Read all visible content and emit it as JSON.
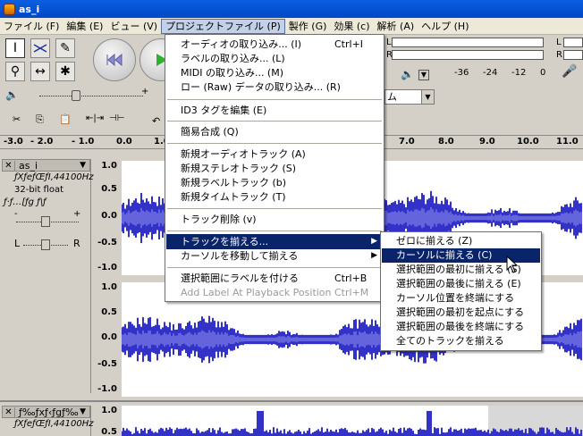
{
  "window": {
    "title": "as_i"
  },
  "menubar": [
    {
      "label": "ファイル (F)"
    },
    {
      "label": "編集 (E)"
    },
    {
      "label": "ビュー (V)"
    },
    {
      "label": "プロジェクトファイル (P)"
    },
    {
      "label": "製作 (G)"
    },
    {
      "label": "効果 (c)"
    },
    {
      "label": "解析 (A)"
    },
    {
      "label": "ヘルプ (H)"
    }
  ],
  "project_menu": {
    "items": [
      {
        "label": "オーディオの取り込み... (I)",
        "shortcut": "Ctrl+I"
      },
      {
        "label": "ラベルの取り込み... (L)",
        "shortcut": ""
      },
      {
        "label": "MIDI の取り込み... (M)",
        "shortcut": ""
      },
      {
        "label": "ロー (Raw) データの取り込み... (R)",
        "shortcut": ""
      },
      {
        "label": "ID3 タグを編集 (E)",
        "shortcut": ""
      },
      {
        "label": "簡易合成 (Q)",
        "shortcut": ""
      },
      {
        "label": "新規オーディオトラック (A)",
        "shortcut": ""
      },
      {
        "label": "新規ステレオトラック (S)",
        "shortcut": ""
      },
      {
        "label": "新規ラベルトラック (b)",
        "shortcut": ""
      },
      {
        "label": "新規タイムトラック (T)",
        "shortcut": ""
      },
      {
        "label": "トラック削除 (v)",
        "shortcut": ""
      },
      {
        "label": "トラックを揃える...",
        "shortcut": ""
      },
      {
        "label": "カーソルを移動して揃える",
        "shortcut": ""
      },
      {
        "label": "選択範囲にラベルを付ける",
        "shortcut": "Ctrl+B"
      },
      {
        "label": "Add Label At Playback Position",
        "shortcut": "Ctrl+M"
      }
    ]
  },
  "align_submenu": {
    "items": [
      {
        "label": "ゼロに揃える (Z)"
      },
      {
        "label": "カーソルに揃える (C)"
      },
      {
        "label": "選択範囲の最初に揃える (S)"
      },
      {
        "label": "選択範囲の最後に揃える (E)"
      },
      {
        "label": "カーソル位置を終端にする"
      },
      {
        "label": "選択範囲の最初を起点にする"
      },
      {
        "label": "選択範囲の最後を終端にする"
      },
      {
        "label": "全てのトラックを揃える"
      }
    ]
  },
  "meter": {
    "left_label": "L",
    "right_label": "R",
    "ticks": [
      "-36",
      "-24",
      "-12",
      "0"
    ]
  },
  "toolbar": {
    "volume_plus": "+"
  },
  "combo": {
    "value": "ム"
  },
  "ruler": {
    "ticks": [
      "-3.0",
      "- 2.0",
      "- 1.0",
      "0.0",
      "1.0",
      "7.0",
      "8.0",
      "9.0",
      "10.0",
      "11.0"
    ]
  },
  "track1": {
    "name": "as_i",
    "line1": "ƒXƒeƒŒƒI,44100Hz",
    "line2": "32-bit float",
    "line3": "ƒ·ƒ…[ƒg ƒ\\ƒ",
    "gain_minus": "-",
    "gain_plus": "+",
    "pan_left": "L",
    "pan_right": "R",
    "scale_top": [
      "1.0",
      "0.5",
      "0.0",
      "-0.5",
      "-1.0"
    ],
    "scale_bottom": [
      "1.0",
      "0.5",
      "0.0",
      "-0.5",
      "-1.0"
    ]
  },
  "track2": {
    "name": "ƒ‰ƒxƒ‹ƒgƒ‰",
    "line1": "ƒXƒeƒŒƒI,44100Hz",
    "scale": [
      "1.0",
      "0.5"
    ]
  },
  "colors": {
    "wave": "#3232c8",
    "wave_light": "#6464dc",
    "menu_highlight": "#0a246a"
  }
}
